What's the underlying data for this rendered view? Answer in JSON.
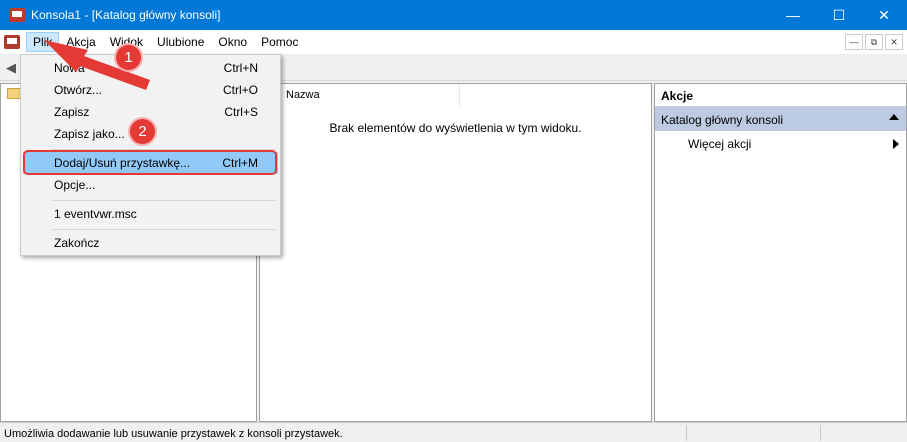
{
  "window": {
    "title": "Konsola1 - [Katalog główny konsoli]",
    "minimize": "—",
    "maximize": "☐",
    "close": "✕"
  },
  "menubar": {
    "items": [
      "Plik",
      "Akcja",
      "Widok",
      "Ulubione",
      "Okno",
      "Pomoc"
    ],
    "mdi_minimize": "—",
    "mdi_restore": "⧉",
    "mdi_close": "✕"
  },
  "file_menu": {
    "items": [
      {
        "label": "Nowa",
        "shortcut": "Ctrl+N"
      },
      {
        "label": "Otwórz...",
        "shortcut": "Ctrl+O"
      },
      {
        "label": "Zapisz",
        "shortcut": "Ctrl+S"
      },
      {
        "label": "Zapisz jako...",
        "shortcut": ""
      },
      {
        "label": "Dodaj/Usuń przystawkę...",
        "shortcut": "Ctrl+M"
      },
      {
        "label": "Opcje...",
        "shortcut": ""
      },
      {
        "label": "1 eventvwr.msc",
        "shortcut": ""
      },
      {
        "label": "Zakończ",
        "shortcut": ""
      }
    ],
    "highlighted_index": 4
  },
  "center_pane": {
    "column_header": "Nazwa",
    "empty_message": "Brak elementów do wyświetlenia w tym widoku."
  },
  "actions_pane": {
    "header": "Akcje",
    "section": "Katalog główny konsoli",
    "more_actions": "Więcej akcji"
  },
  "status_bar": {
    "text": "Umożliwia dodawanie lub usuwanie przystawek z konsoli przystawek."
  },
  "annotations": {
    "badge_1": "1",
    "badge_2": "2",
    "color": "#e53935"
  },
  "colors": {
    "titlebar": "#0078d7",
    "menu_highlight": "#91c9f7",
    "actions_section": "#bccbe2"
  }
}
